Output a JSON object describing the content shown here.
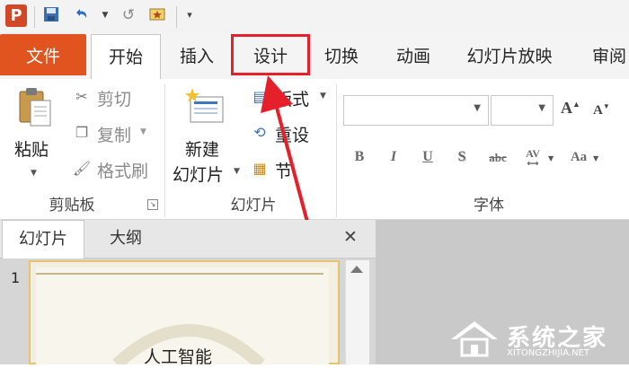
{
  "app": {
    "logo_letter": "P"
  },
  "quick_access": {
    "icons": [
      "save-icon",
      "undo-icon",
      "redo-icon",
      "slideshow-icon",
      "customize-icon"
    ]
  },
  "tabs": [
    {
      "label": "文件",
      "id": "file"
    },
    {
      "label": "开始",
      "id": "home",
      "active": true
    },
    {
      "label": "插入",
      "id": "insert"
    },
    {
      "label": "设计",
      "id": "design",
      "highlighted": true
    },
    {
      "label": "切换",
      "id": "transitions"
    },
    {
      "label": "动画",
      "id": "animations"
    },
    {
      "label": "幻灯片放映",
      "id": "slideshow"
    },
    {
      "label": "审阅",
      "id": "review"
    }
  ],
  "clipboard": {
    "paste": "粘贴",
    "cut": "剪切",
    "copy": "复制",
    "format_painter": "格式刷",
    "group_label": "剪贴板"
  },
  "slides_group": {
    "new_slide_line1": "新建",
    "new_slide_line2": "幻灯片",
    "layout": "版式",
    "reset": "重设",
    "section": "节",
    "group_label": "幻灯片"
  },
  "font_group": {
    "font_name": "",
    "font_size": "",
    "grow": "A",
    "shrink": "A",
    "bold": "B",
    "italic": "I",
    "underline": "U",
    "shadow": "S",
    "strike": "abc",
    "spacing": "AV",
    "case": "Aa",
    "group_label": "字体"
  },
  "panel": {
    "tab_slides": "幻灯片",
    "tab_outline": "大纲",
    "close": "✕",
    "slide_number": "1",
    "slide_title": "人工智能"
  },
  "watermark": {
    "title": "系统之家",
    "url": "XITONGZHIJIA.NET"
  },
  "colors": {
    "file_tab": "#e2541f",
    "highlight": "#e5202b",
    "accent": "#2f6fb6"
  }
}
